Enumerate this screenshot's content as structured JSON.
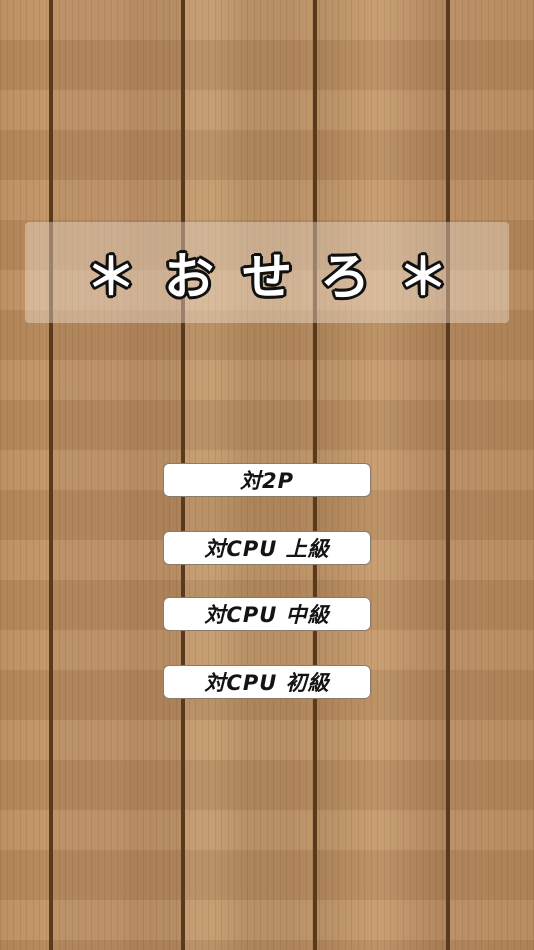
{
  "title": {
    "text": "＊おせろ＊"
  },
  "menu": {
    "items": [
      {
        "label": "対2P"
      },
      {
        "label": "対CPU 上級"
      },
      {
        "label": "対CPU 中級"
      },
      {
        "label": "対CPU 初級"
      }
    ]
  },
  "colors": {
    "wood": "#b8875a",
    "wood_seam": "#5a3a1e",
    "panel": "#f0e4d6",
    "button": "#ffffff",
    "label": "#141414"
  }
}
